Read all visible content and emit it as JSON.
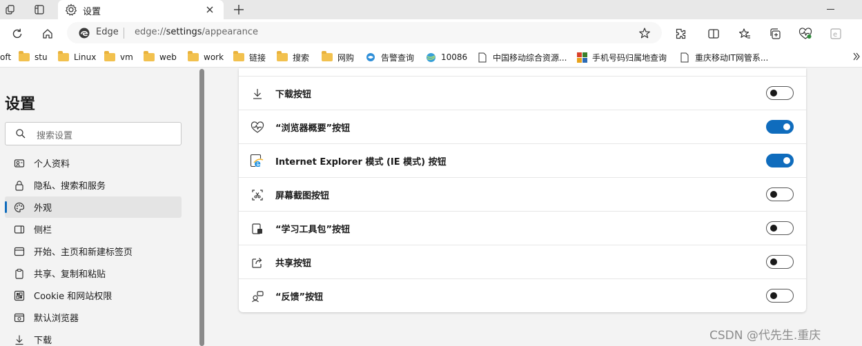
{
  "tab": {
    "title": "设置"
  },
  "address": {
    "site": "Edge",
    "url_prefix": "edge://",
    "url_host": "settings",
    "url_path": "/appearance"
  },
  "bookmarks": [
    {
      "label": "oft",
      "kind": "none"
    },
    {
      "label": "stu",
      "kind": "folder"
    },
    {
      "label": "Linux",
      "kind": "folder"
    },
    {
      "label": "vm",
      "kind": "folder"
    },
    {
      "label": "web",
      "kind": "folder"
    },
    {
      "label": "work",
      "kind": "folder"
    },
    {
      "label": "链接",
      "kind": "folder"
    },
    {
      "label": "搜索",
      "kind": "folder"
    },
    {
      "label": "网购",
      "kind": "folder"
    },
    {
      "label": "告警查询",
      "kind": "site"
    },
    {
      "label": "10086",
      "kind": "site"
    },
    {
      "label": "中国移动综合资源...",
      "kind": "page"
    },
    {
      "label": "手机号码归属地查询",
      "kind": "site"
    },
    {
      "label": "重庆移动IT网管系...",
      "kind": "page"
    }
  ],
  "sidebar": {
    "title": "设置",
    "search_placeholder": "搜索设置",
    "items": [
      {
        "label": "个人资料",
        "icon": "profile-icon"
      },
      {
        "label": "隐私、搜索和服务",
        "icon": "lock-icon"
      },
      {
        "label": "外观",
        "icon": "palette-icon",
        "active": true
      },
      {
        "label": "侧栏",
        "icon": "sidebar-icon"
      },
      {
        "label": "开始、主页和新建标签页",
        "icon": "home-icon"
      },
      {
        "label": "共享、复制和粘贴",
        "icon": "share-icon"
      },
      {
        "label": "Cookie 和网站权限",
        "icon": "cookie-icon"
      },
      {
        "label": "默认浏览器",
        "icon": "browser-icon"
      },
      {
        "label": "下载",
        "icon": "download-icon"
      }
    ]
  },
  "settings_rows": [
    {
      "label": "下载按钮",
      "icon": "download-icon",
      "on": false
    },
    {
      "label": "“浏览器概要”按钮",
      "icon": "heartbeat-icon",
      "on": true
    },
    {
      "label": "Internet Explorer 模式 (IE 模式) 按钮",
      "icon": "ie-icon",
      "on": true
    },
    {
      "label": "屏幕截图按钮",
      "icon": "screenshot-icon",
      "on": false
    },
    {
      "label": "“学习工具包”按钮",
      "icon": "learning-icon",
      "on": false
    },
    {
      "label": "共享按钮",
      "icon": "share-icon",
      "on": false
    },
    {
      "label": "“反馈”按钮",
      "icon": "feedback-icon",
      "on": false
    }
  ],
  "watermark": "CSDN @代先生.重庆",
  "colors": {
    "accent": "#0f6cbd",
    "folder": "#f2c14e"
  }
}
